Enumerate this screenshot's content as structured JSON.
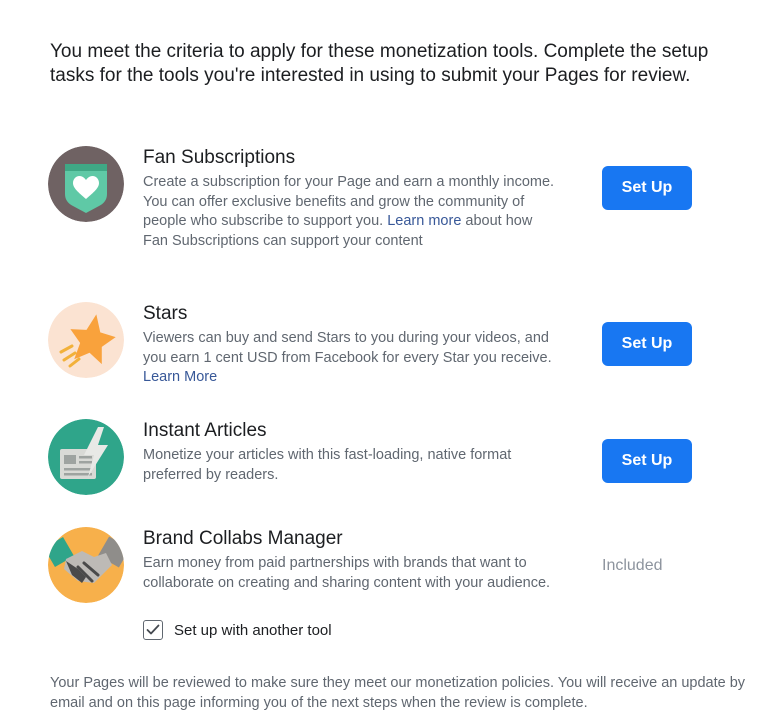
{
  "intro": "You meet the criteria to apply for these monetization tools. Complete the setup tasks for the tools you're interested in using to submit your Pages for review.",
  "tools": [
    {
      "title": "Fan Subscriptions",
      "desc_before": "Create a subscription for your Page and earn a monthly income. You can offer exclusive benefits and grow the community of people who subscribe to support you. ",
      "link": "Learn more",
      "desc_after": " about how Fan Subscriptions can support your content",
      "action": "Set Up",
      "icon": "heart-badge-icon"
    },
    {
      "title": "Stars",
      "desc_before": "Viewers can buy and send Stars to you during your videos, and you earn 1 cent USD from Facebook for every Star you receive. ",
      "link": "Learn More",
      "desc_after": "",
      "action": "Set Up",
      "icon": "star-icon"
    },
    {
      "title": "Instant Articles",
      "desc_before": "Monetize your articles with this fast-loading, native format preferred by readers.",
      "link": "",
      "desc_after": "",
      "action": "Set Up",
      "icon": "lightning-article-icon"
    },
    {
      "title": "Brand Collabs Manager",
      "desc_before": "Earn money from paid partnerships with brands that want to collaborate on creating and sharing content with your audience.",
      "link": "",
      "desc_after": "",
      "status": "Included",
      "checkbox_label": "Set up with another tool",
      "checkbox_checked": true,
      "icon": "handshake-icon"
    }
  ],
  "footer": "Your Pages will be reviewed to make sure they meet our monetization policies. You will receive an update by email and on this page informing you of the next steps when the review is complete.",
  "colors": {
    "primary_button": "#1877f2",
    "link": "#385898",
    "muted_text": "#606770"
  }
}
